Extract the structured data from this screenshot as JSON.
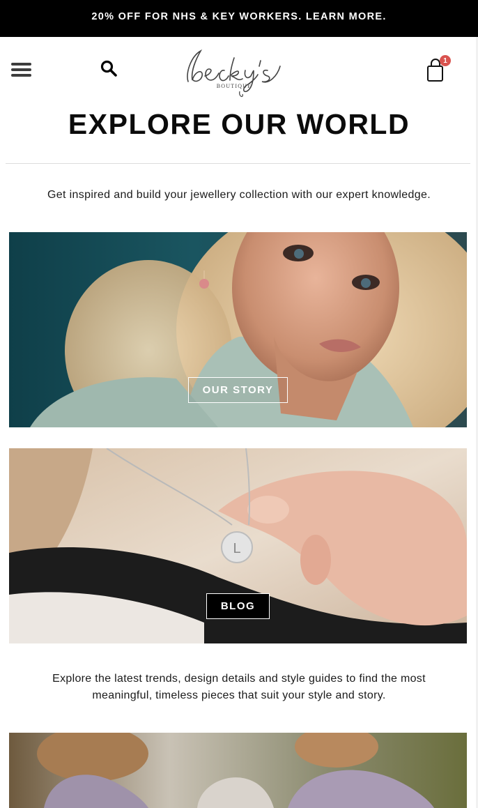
{
  "promo": {
    "text": "20% OFF FOR NHS & KEY WORKERS. LEARN MORE."
  },
  "header": {
    "menu_icon": "hamburger-menu-icon",
    "search_icon": "search-icon",
    "logo": {
      "name": "becky's",
      "sub": "BOUTIQUE"
    },
    "cart_icon": "shopping-bag-icon",
    "cart_count": "1"
  },
  "main": {
    "title": "EXPLORE OUR WORLD",
    "intro": "Get inspired and build your jewellery collection with our expert knowledge.",
    "tiles": [
      {
        "label": "OUR STORY",
        "image": "woman-portrait-earrings"
      },
      {
        "label": "BLOG",
        "image": "hand-holding-initial-necklace"
      },
      {
        "image": "bridesmaids-lilac-dresses"
      }
    ],
    "explore_text": "Explore the latest trends, design details and style guides to find the most meaningful, timeless pieces that suit your style and story."
  },
  "colors": {
    "promo_bg": "#000000",
    "badge": "#d9534f",
    "text": "#111111"
  }
}
